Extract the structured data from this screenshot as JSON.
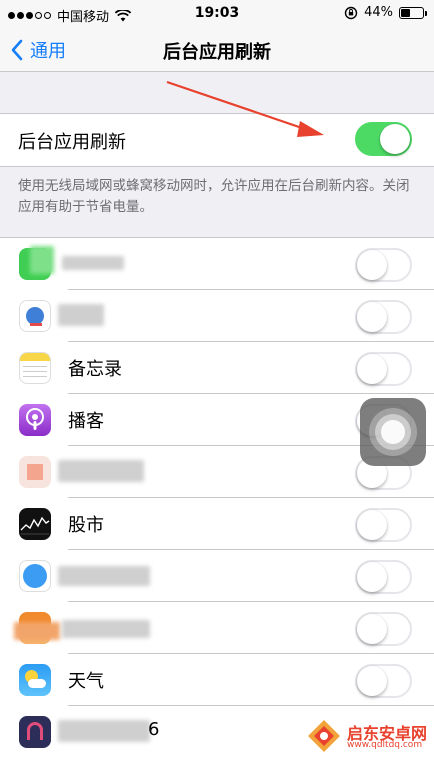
{
  "status_bar": {
    "carrier": "中国移动",
    "time": "19:03",
    "battery": "44%",
    "battery_level": 0.44
  },
  "nav": {
    "back_label": "通用",
    "title": "后台应用刷新"
  },
  "main_toggle": {
    "label": "后台应用刷新",
    "on": true
  },
  "footer_note": "使用无线局域网或蜂窝移动网时，允许应用在后台刷新内容。关闭应用有助于节省电量。",
  "apps": [
    {
      "label": "",
      "icon": "green-app-icon",
      "obscured": true,
      "on": false
    },
    {
      "label": "",
      "icon": "blue-app-icon",
      "obscured": true,
      "on": false
    },
    {
      "label": "备忘录",
      "icon": "notes-icon",
      "obscured": false,
      "on": false
    },
    {
      "label": "播客",
      "icon": "podcasts-icon",
      "obscured": false,
      "on": false
    },
    {
      "label": "",
      "icon": "pink-app-icon",
      "obscured": true,
      "on": false
    },
    {
      "label": "股市",
      "icon": "stocks-icon",
      "obscured": false,
      "on": false
    },
    {
      "label": "",
      "icon": "blue-circle-app-icon",
      "obscured": true,
      "on": false
    },
    {
      "label": "",
      "icon": "orange-app-icon",
      "obscured": true,
      "on": false
    },
    {
      "label": "天气",
      "icon": "weather-icon",
      "obscured": false,
      "on": false
    },
    {
      "label": "6",
      "icon": "purple-app-icon",
      "obscured": true,
      "on": false
    }
  ],
  "watermark": {
    "name": "启东安卓网",
    "url": "www.qdltdq.com"
  },
  "colors": {
    "accent": "#157efb",
    "switch_on": "#4cd964",
    "annotation_arrow": "#e8412d"
  }
}
